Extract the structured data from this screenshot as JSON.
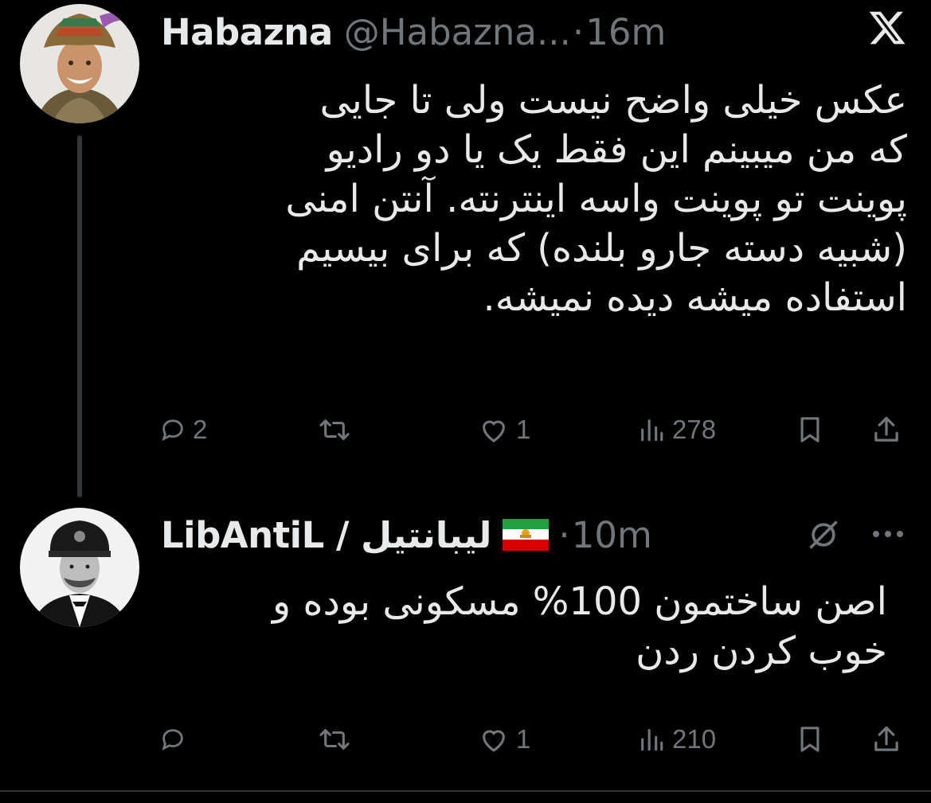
{
  "tweets": [
    {
      "author_name": "Habazna",
      "handle": "@Habazna...",
      "separator": "·",
      "time": "16m",
      "text": "عکس خیلی واضح نیست ولی تا جایی\nکه من میبینم این فقط یک یا دو رادیو\nپوینت تو پوینت واسه اینترنته. آنتن امنی\n(شبیه دسته جارو بلنده) که برای بیسیم\nاستفاده میشه دیده نمیشه.",
      "replies": "2",
      "retweets": "",
      "likes": "1",
      "views": "278"
    },
    {
      "author_name": "LibAntiL / لیبانتیل",
      "time": "10m",
      "separator": "·",
      "text": "اصن ساختمون 100% مسکونی بوده و\nخوب کردن ردن",
      "replies": "",
      "retweets": "",
      "likes": "1",
      "views": "210"
    }
  ],
  "icons": {
    "x_logo": "x-logo-icon",
    "more": "more-icon",
    "grok": "grok-icon",
    "flag": "iran-lion-sun-flag"
  },
  "colors": {
    "background": "#000000",
    "text": "#e7e9ea",
    "muted": "#71767b",
    "thread_line": "#333639"
  }
}
